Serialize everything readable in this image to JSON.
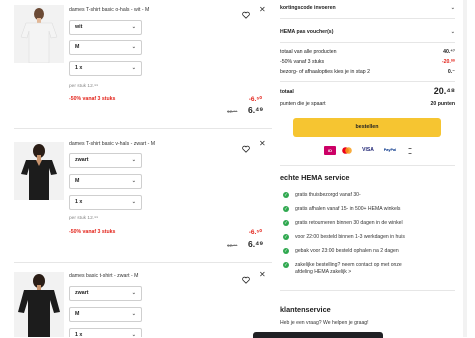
{
  "products": [
    {
      "name": "dames T-shirt basic o-hals - wit - M",
      "color": "wit",
      "size": "M",
      "quantity": "1 x",
      "per_stuk": "per stuk 12.⁹⁹",
      "promo": "-50% vanaf 3 stuks",
      "discount": "-6.⁵⁰",
      "old_price": "12.⁹⁹",
      "new_price": "6.⁴⁹",
      "shirt_color": "#f4f4f4"
    },
    {
      "name": "dames T-shirt basic v-hals - zwart - M",
      "color": "zwart",
      "size": "M",
      "quantity": "1 x",
      "per_stuk": "per stuk 12.⁹⁹",
      "promo": "-50% vanaf 3 stuks",
      "discount": "-6.⁵⁰",
      "old_price": "12.⁹⁹",
      "new_price": "6.⁴⁹",
      "shirt_color": "#1c1c1c"
    },
    {
      "name": "dames basic t-shirt - zwart - M",
      "color": "zwart",
      "size": "M",
      "quantity": "1 x",
      "shirt_color": "#1c1c1c"
    }
  ],
  "summary": {
    "kortingscode": "kortingscode invoeren",
    "voucher": "HEMA pas voucher(s)",
    "rows": [
      {
        "label": "totaal van alle producten",
        "value": "40.⁴⁷",
        "red": false
      },
      {
        "label": "-50% vanaf 3 stuks",
        "value": "-20.⁰⁰",
        "red": true
      },
      {
        "label": "bezorg- of afhaalopties kies je in stap 2",
        "value": "0.⁻",
        "red": false
      }
    ],
    "total_label": "totaal",
    "total_value": "20.⁴⁸",
    "points_label": "punten die je spaart",
    "points_value": "20 punten",
    "button_label": "bestellen"
  },
  "payment_methods": [
    {
      "name": "iDEAL",
      "bg": "#cc0066",
      "fg": "#ffffff"
    },
    {
      "name": "MC",
      "bg": "#ffffff",
      "fg": "#eb001b"
    },
    {
      "name": "VISA",
      "bg": "#ffffff",
      "fg": "#1a1f71"
    },
    {
      "name": "PayPal",
      "bg": "#ffffff",
      "fg": "#003087"
    },
    {
      "name": "afterpay",
      "bg": "#ffffff",
      "fg": "#555555"
    }
  ],
  "service": {
    "title": "echte HEMA service",
    "items": [
      "gratis thuisbezorgd vanaf 30-",
      "gratis afhalen vanaf 15- in 500+ HEMA winkels",
      "gratis retourneren binnen 30 dagen in de winkel",
      "voor 22:00 besteld binnen 1-3 werkdagen in huis",
      "gebak voor 23:00 besteld ophalen na 2 dagen",
      "zakelijke bestelling? neem contact op met onze",
      "afdeling HEMA zakelijk >"
    ]
  },
  "klantenservice": {
    "title": "klantenservice",
    "text": "Heb je een vraag? We helpen je graag!"
  },
  "colors": {
    "accent_yellow": "#f6c531",
    "promo_red": "#e3241b",
    "check_green": "#2fa84f"
  }
}
